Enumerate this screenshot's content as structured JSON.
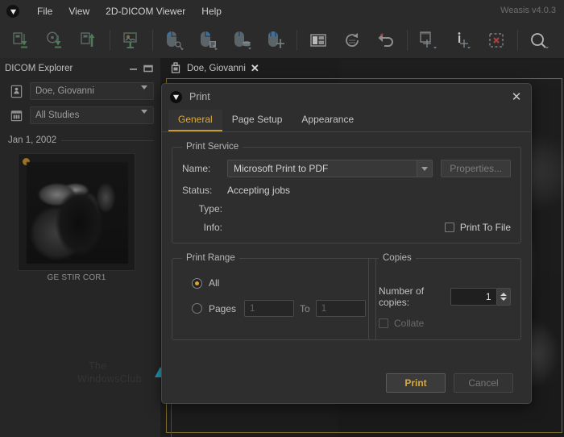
{
  "app": {
    "title": "Weasis",
    "version_label": "Weasis v4.0.3",
    "badge_icon": "weasis-logo-icon"
  },
  "menubar": {
    "items": [
      {
        "label": "File",
        "name": "menu-file"
      },
      {
        "label": "View",
        "name": "menu-view"
      },
      {
        "label": "2D-DICOM Viewer",
        "name": "menu-2d-dicom-viewer"
      },
      {
        "label": "Help",
        "name": "menu-help"
      }
    ]
  },
  "toolbar": {
    "groups": [
      [
        "import-dicom-icon",
        "import-cd-icon",
        "export-dicom-icon"
      ],
      [
        "import-image-icon"
      ],
      [
        "mouse-left-action-icon",
        "mouse-right-action-icon",
        "mouse-wheel-action-icon",
        "mouse-middle-action-icon"
      ],
      [
        "layout-icon",
        "reset-rotate-icon",
        "undo-icon"
      ],
      [
        "measure-icon",
        "annotation-icon",
        "delete-drawing-icon"
      ],
      [
        "zoom-icon"
      ]
    ]
  },
  "explorer": {
    "title": "DICOM Explorer",
    "minimize_icon": "minimize-icon",
    "maximize_icon": "maximize-icon",
    "patient_combo": {
      "value": "Doe, Giovanni",
      "icon": "patient-icon"
    },
    "studies_combo": {
      "value": "All Studies",
      "icon": "calendar-icon"
    },
    "study_date": "Jan 1, 2002",
    "thumbnail": {
      "label": "GE STIR COR1",
      "badge": "series-badge"
    }
  },
  "viewer": {
    "series_tab": {
      "label": "Doe, Giovanni",
      "icon": "patient-tab-icon",
      "close_icon": "close-icon"
    }
  },
  "watermark": {
    "line1": "The",
    "line2": "WindowsClub",
    "logo_color": "#1f9ab5"
  },
  "dialog": {
    "title": "Print",
    "icon": "weasis-logo-icon",
    "close_icon": "close-icon",
    "tabs": [
      {
        "label": "General",
        "active": true
      },
      {
        "label": "Page Setup",
        "active": false
      },
      {
        "label": "Appearance",
        "active": false
      }
    ],
    "print_service": {
      "legend": "Print Service",
      "name_label": "Name:",
      "name_value": "Microsoft Print to PDF",
      "properties_button": "Properties...",
      "status_label": "Status:",
      "status_value": "Accepting jobs",
      "type_label": "Type:",
      "type_value": "",
      "info_label": "Info:",
      "info_value": "",
      "print_to_file_label": "Print To File",
      "print_to_file_checked": false
    },
    "print_range": {
      "legend": "Print Range",
      "all_label": "All",
      "all_selected": true,
      "pages_label": "Pages",
      "pages_selected": false,
      "pages_from": "1",
      "to_label": "To",
      "pages_to": "1"
    },
    "copies": {
      "legend": "Copies",
      "number_label": "Number of copies:",
      "number_value": "1",
      "collate_label": "Collate",
      "collate_checked": false,
      "collate_enabled": false
    },
    "buttons": {
      "print": "Print",
      "cancel": "Cancel"
    },
    "accent_color": "#d8a93d"
  }
}
